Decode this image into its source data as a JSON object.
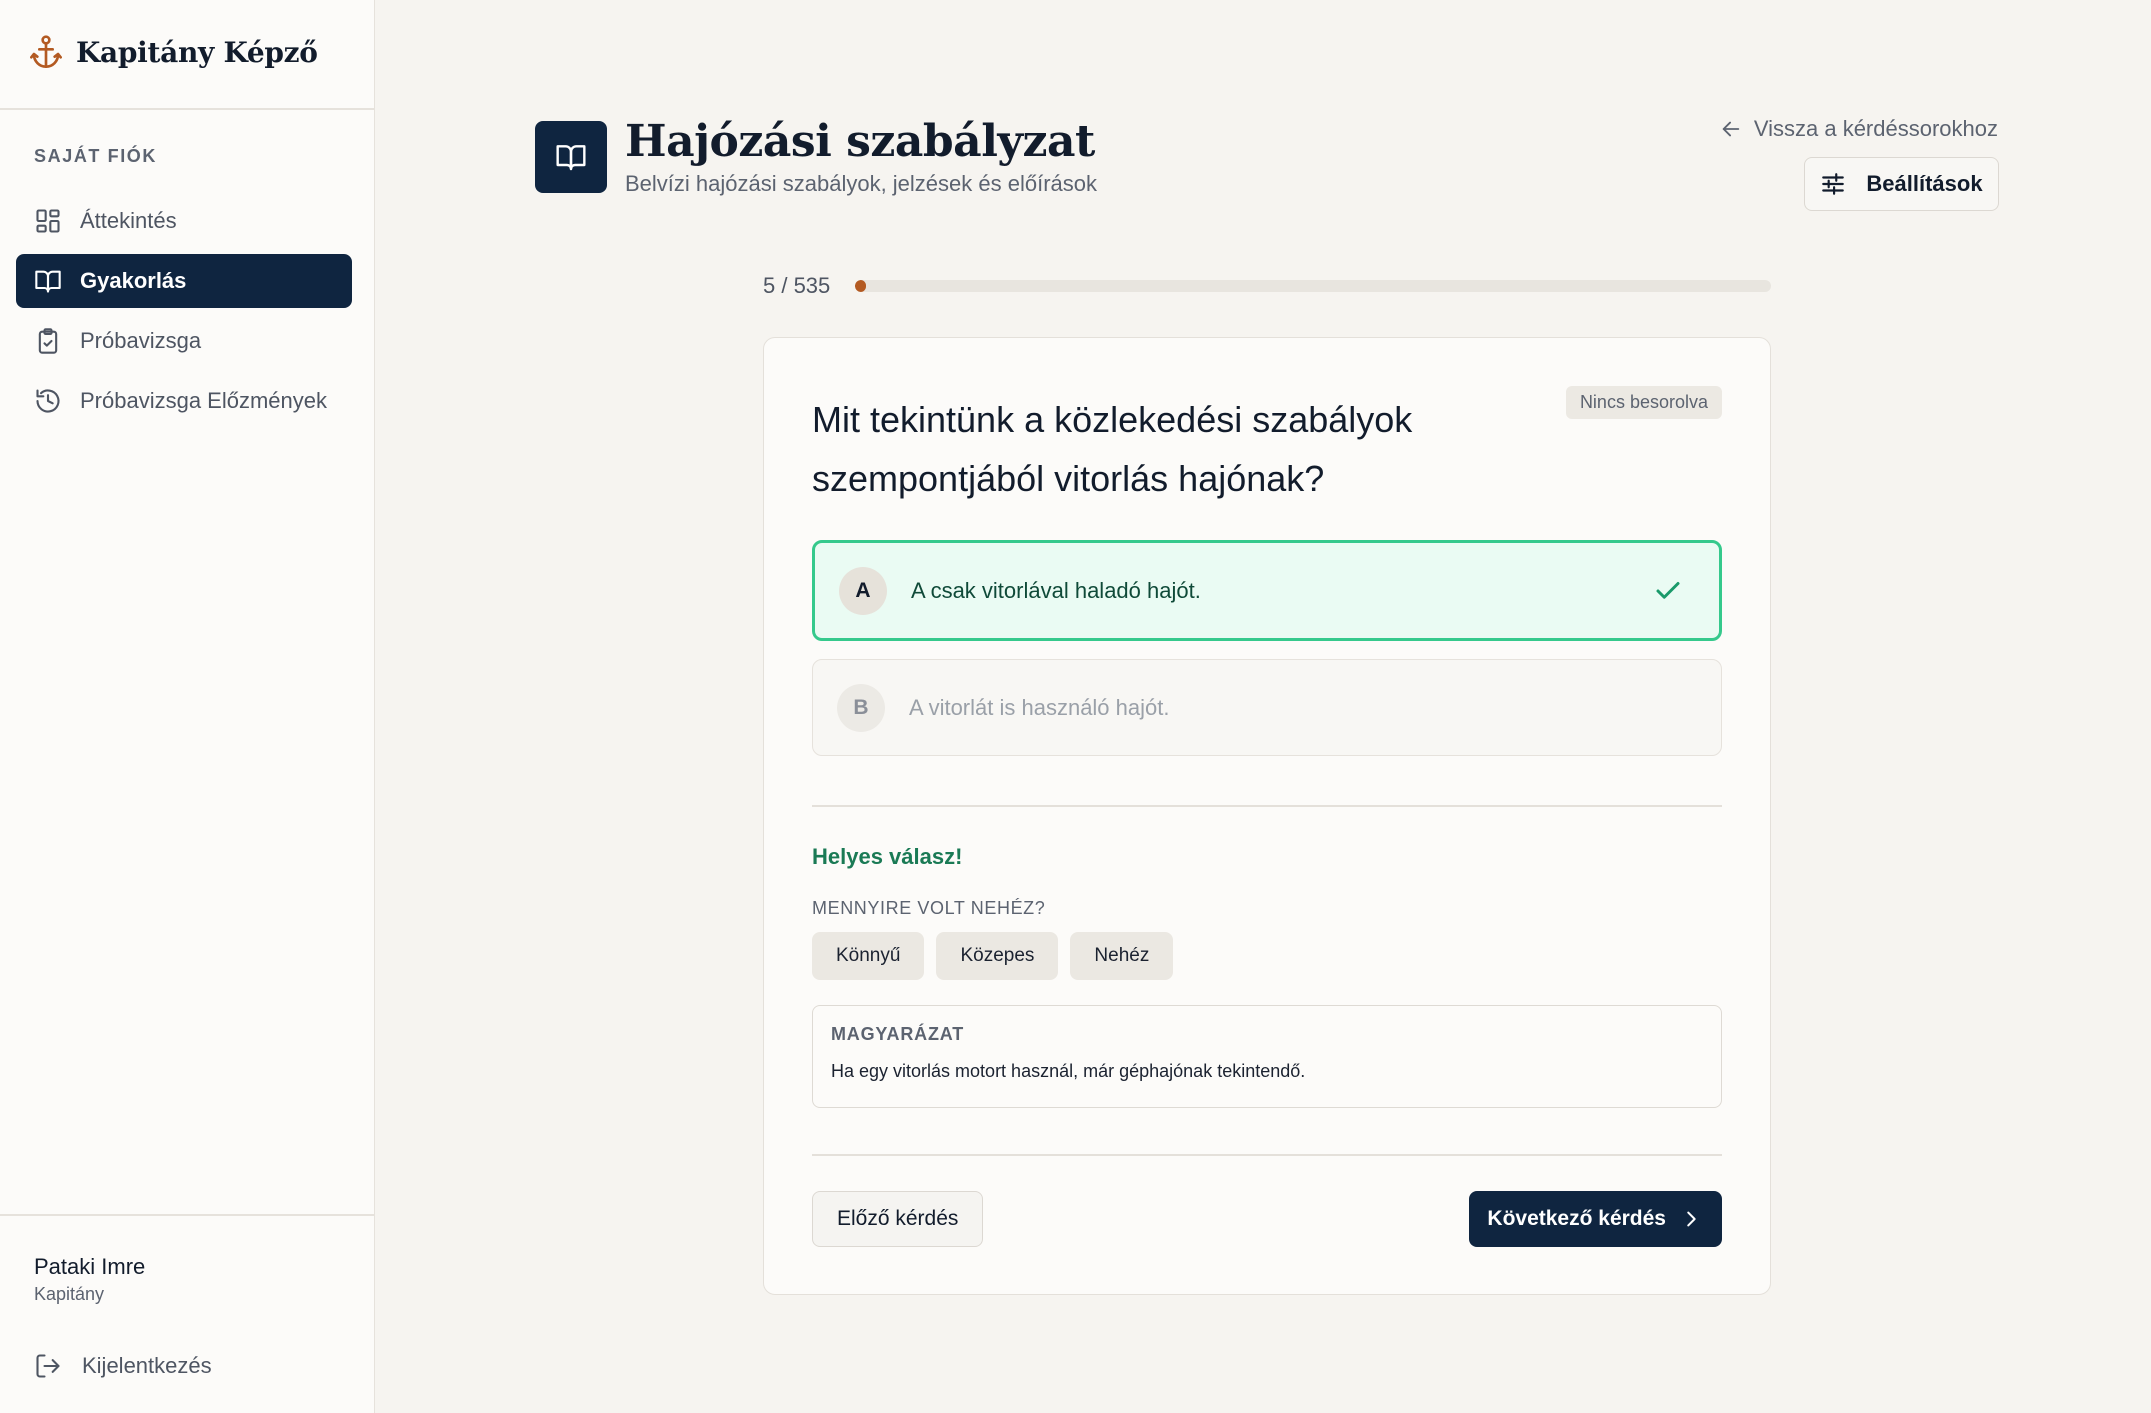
{
  "app": {
    "brand": "Kapitány Képző"
  },
  "sidebar": {
    "section_label": "SAJÁT FIÓK",
    "items": [
      {
        "label": "Áttekintés",
        "icon": "grid-icon",
        "active": false
      },
      {
        "label": "Gyakorlás",
        "icon": "book-icon",
        "active": true
      },
      {
        "label": "Próbavizsga",
        "icon": "clipboard-check-icon",
        "active": false
      },
      {
        "label": "Próbavizsga Előzmények",
        "icon": "history-icon",
        "active": false
      }
    ],
    "user": {
      "name": "Pataki Imre",
      "role": "Kapitány"
    },
    "logout_label": "Kijelentkezés"
  },
  "header": {
    "title": "Hajózási szabályzat",
    "subtitle": "Belvízi hajózási szabályok, jelzések és előírások",
    "back_label": "Vissza a kérdéssorokhoz",
    "settings_label": "Beállítások"
  },
  "progress": {
    "label": "5 / 535",
    "current": 5,
    "total": 535
  },
  "question": {
    "text": "Mit tekintünk a közlekedési szabályok szempontjából vitorlás hajónak?",
    "tag": "Nincs besorolva",
    "options": [
      {
        "letter": "A",
        "text": "A csak vitorlával haladó hajót.",
        "state": "correct"
      },
      {
        "letter": "B",
        "text": "A vitorlát is használó hajót.",
        "state": "neutral"
      }
    ],
    "result": "Helyes válasz!",
    "difficulty_label": "MENNYIRE VOLT NEHÉZ?",
    "difficulty_options": [
      "Könnyű",
      "Közepes",
      "Nehéz"
    ],
    "explanation_label": "MAGYARÁZAT",
    "explanation_text": "Ha egy vitorlás motort használ, már géphajónak tekintendő.",
    "prev_label": "Előző kérdés",
    "next_label": "Következő kérdés"
  },
  "colors": {
    "navy": "#0f2540",
    "accent": "#b35a22",
    "correct_border": "#35c98c",
    "correct_bg": "#eafbf3",
    "correct_text": "#1a7a55"
  }
}
